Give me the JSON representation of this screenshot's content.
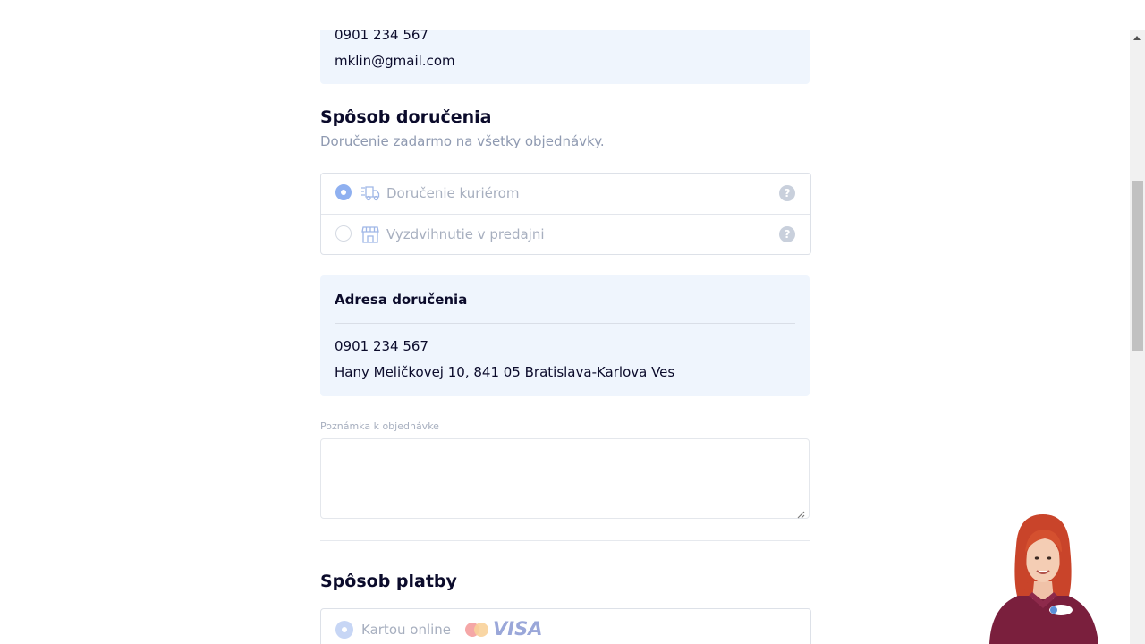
{
  "contact": {
    "phone": "0901 234 567",
    "email": "mklin@gmail.com"
  },
  "delivery": {
    "title": "Spôsob doručenia",
    "subtitle": "Doručenie zadarmo na všetky objednávky.",
    "options": [
      {
        "label": "Doručenie kuriérom",
        "selected": true,
        "icon": "truck-icon",
        "help": "?"
      },
      {
        "label": "Vyzdvihnutie v predajni",
        "selected": false,
        "icon": "store-icon",
        "help": "?"
      }
    ]
  },
  "address": {
    "title": "Adresa doručenia",
    "phone": "0901 234 567",
    "line": "Hany Meličkovej 10, 841 05 Bratislava-Karlova Ves"
  },
  "note": {
    "label": "Poznámka k objednávke",
    "value": ""
  },
  "payment": {
    "title": "Spôsob platby",
    "options": [
      {
        "label": "Kartou online",
        "selected": true,
        "brand_logo": "VISA",
        "icon": "mastercard-icon"
      }
    ]
  },
  "colors": {
    "accent": "#8fb0f0",
    "info_box": "#eff5fd",
    "muted_text": "#a7afbf"
  }
}
